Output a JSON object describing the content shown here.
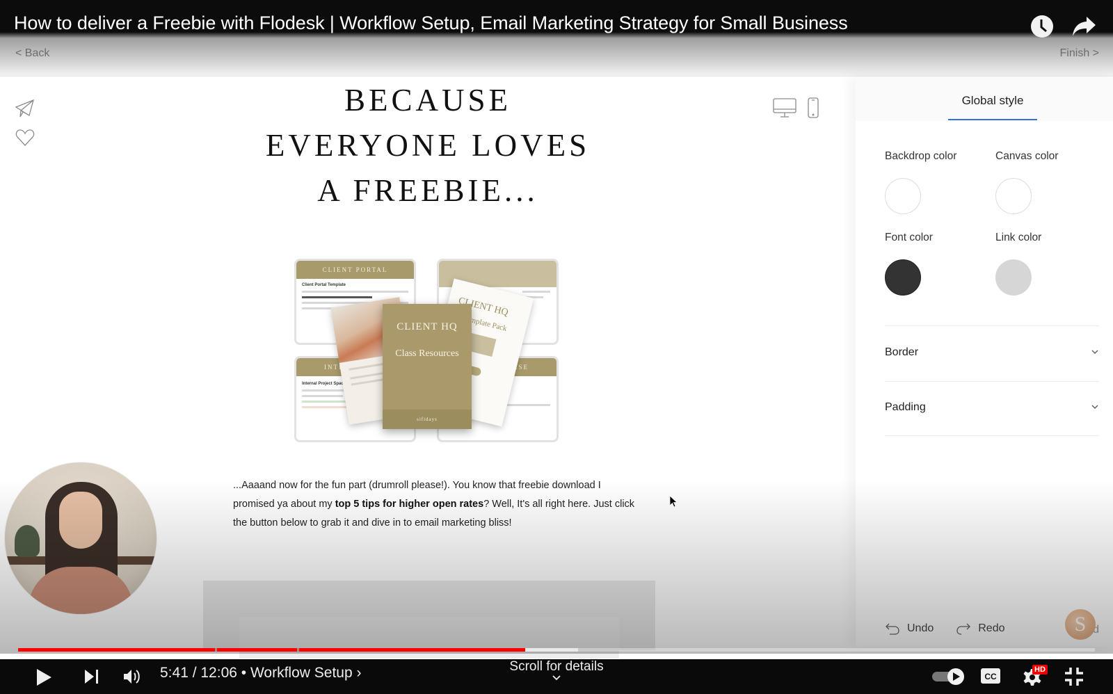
{
  "video": {
    "title": "How to deliver a Freebie with Flodesk | Workflow Setup, Email Marketing Strategy for Small Business",
    "current_time": "5:41",
    "duration": "12:06",
    "time_display": "5:41 / 12:06",
    "chapter_separator": "•",
    "chapter": "Workflow Setup",
    "chapter_chevron": "›",
    "scroll_hint": "Scroll for details",
    "progress_fraction": 0.471,
    "buffered_fraction": 0.52,
    "chapter_markers_fraction": [
      0.183,
      0.259
    ],
    "hd_badge": "HD",
    "icons": {
      "watch_later": "clock-icon",
      "share": "share-arrow-icon",
      "play": "play-icon",
      "next": "skip-next-icon",
      "volume": "volume-icon",
      "autoplay": "autoplay-toggle-icon",
      "captions": "cc-icon",
      "settings": "gear-icon",
      "exit_fullscreen": "exit-fullscreen-icon"
    }
  },
  "editor": {
    "back_label": "< Back",
    "finish_label": "Finish >",
    "left_tools": [
      "paper-plane-icon",
      "heart-icon"
    ],
    "device_toggle": [
      "desktop-icon",
      "mobile-icon"
    ],
    "email": {
      "headline_lines": [
        "BECAUSE",
        "EVERYONE LOVES",
        "A FREEBIE..."
      ],
      "mockup": {
        "card_top_left": "CLIENT PORTAL",
        "card_top_left_subtitle": "Client Portal Template",
        "card_bottom_left": "INTERN",
        "card_bottom_left_subtitle": "Internal Project Space Temp",
        "card_bottom_right": "ATABASE",
        "tilted_title": "CLIENT HQ",
        "tilted_subtitle": "Template Pack",
        "cover_title": "CLIENT HQ",
        "cover_subtitle": "Class Resources",
        "cover_footer": "sifidays"
      },
      "body": {
        "part1": "...Aaaand now for the fun part (drumroll please!). You know that freebie download I promised ya about my ",
        "bold": "top 5 tips for higher open rates",
        "part2": "? Well, It's all right here. Just click the button below to grab it and dive in to email marketing bliss!"
      }
    },
    "panel": {
      "tab": "Global style",
      "colors": [
        {
          "label": "Backdrop color",
          "value": "#ffffff"
        },
        {
          "label": "Canvas color",
          "value": "#ffffff"
        },
        {
          "label": "Font color",
          "value": "#333333"
        },
        {
          "label": "Link color",
          "value": "#d6d6d6"
        }
      ],
      "sections": [
        "Border",
        "Padding"
      ],
      "undo_label": "Undo",
      "redo_label": "Redo",
      "status": "Saved",
      "logo_letter": "S"
    },
    "accent_color": "#2f6fe0"
  }
}
